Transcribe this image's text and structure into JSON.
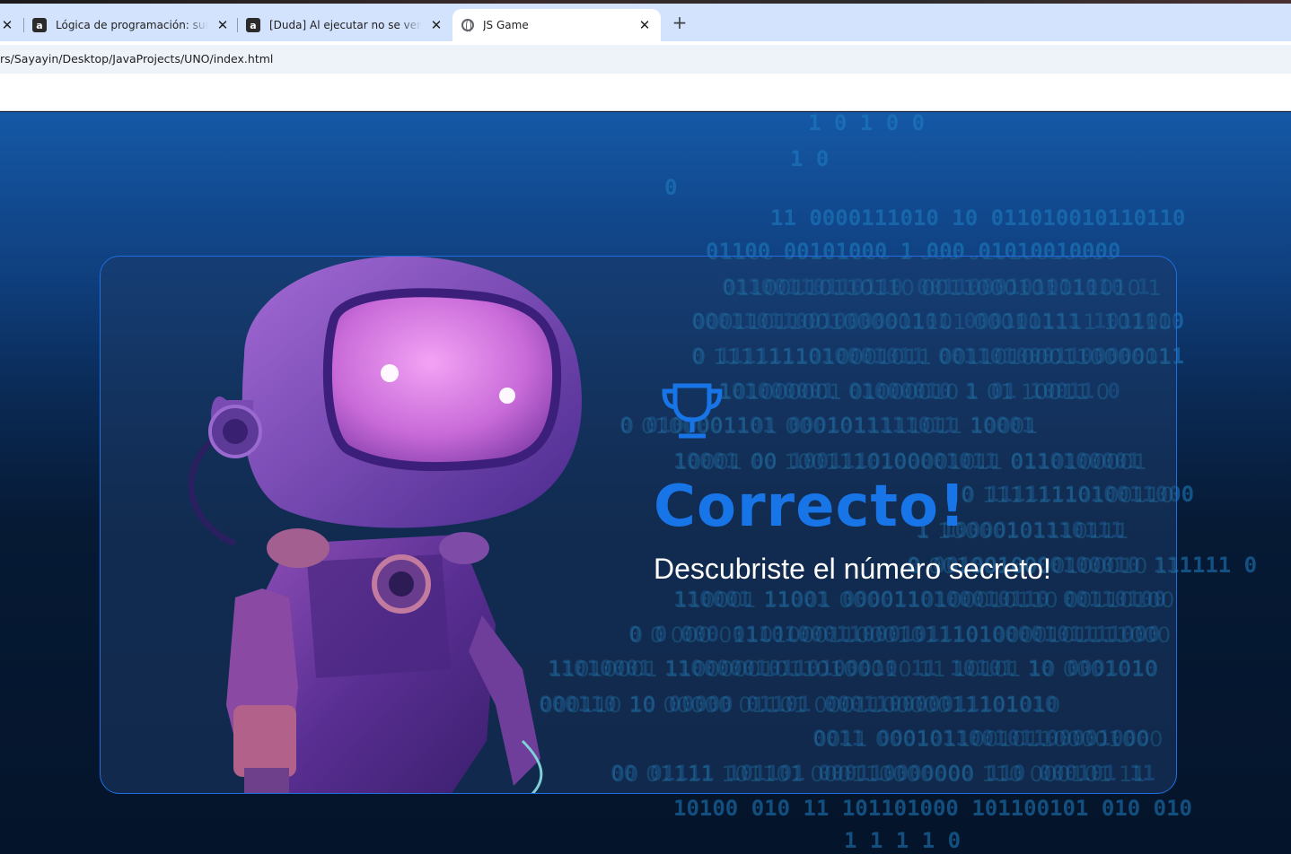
{
  "browser": {
    "tabs": [
      {
        "title": "",
        "icon": "close-icon"
      },
      {
        "title": "Lógica de programación: sumér",
        "icon": "alura-icon"
      },
      {
        "title": "[Duda] Al ejecutar no se ven las",
        "icon": "alura-icon"
      },
      {
        "title": "JS Game",
        "icon": "globe-icon",
        "active": true
      }
    ],
    "favicon_letter": "a",
    "new_tab": "+",
    "close_glyph": "✕",
    "address": "rs/Sayayin/Desktop/JavaProjects/UNO/index.html"
  },
  "game": {
    "title": "Correcto!",
    "subtitle": "Descubriste el número secreto!",
    "trophy_icon": "trophy-icon",
    "accent_color": "#1875e8",
    "card_border_color": "#1f6fe0"
  },
  "background_binary": [
    "1 0 1 0 0",
    "1 0",
    "0",
    "11 0000111010 10 011010010110110",
    "01100 00101000 1 000 01010010000",
    "01100110110110 0011000101011010 1",
    "00011011001000001101 000101111 1011010",
    "0 1111111010001011 0011010001100000111",
    "101000001 01000010 1 01 10011 0",
    "0 0100001101 0001011111011 10001",
    "10001 00 1001110100001011 0110100001",
    "0 1111111010011000",
    "1 10000101110111",
    "0 0010010000100010 111111 0",
    "110001 11001 0000110100010110 00110100",
    "0 0 000 011010001100010111010000101111000",
    "11010001 110000010110100010 11 10101 10 0001010",
    "000110 10 00000 01101 000110000011101010",
    "0011 000101100101100001000",
    "00 01111 101101 000110000000 110 000101 11",
    "10100 010 11 101101000 101100101 010 010",
    "1 1 1 1 0"
  ]
}
